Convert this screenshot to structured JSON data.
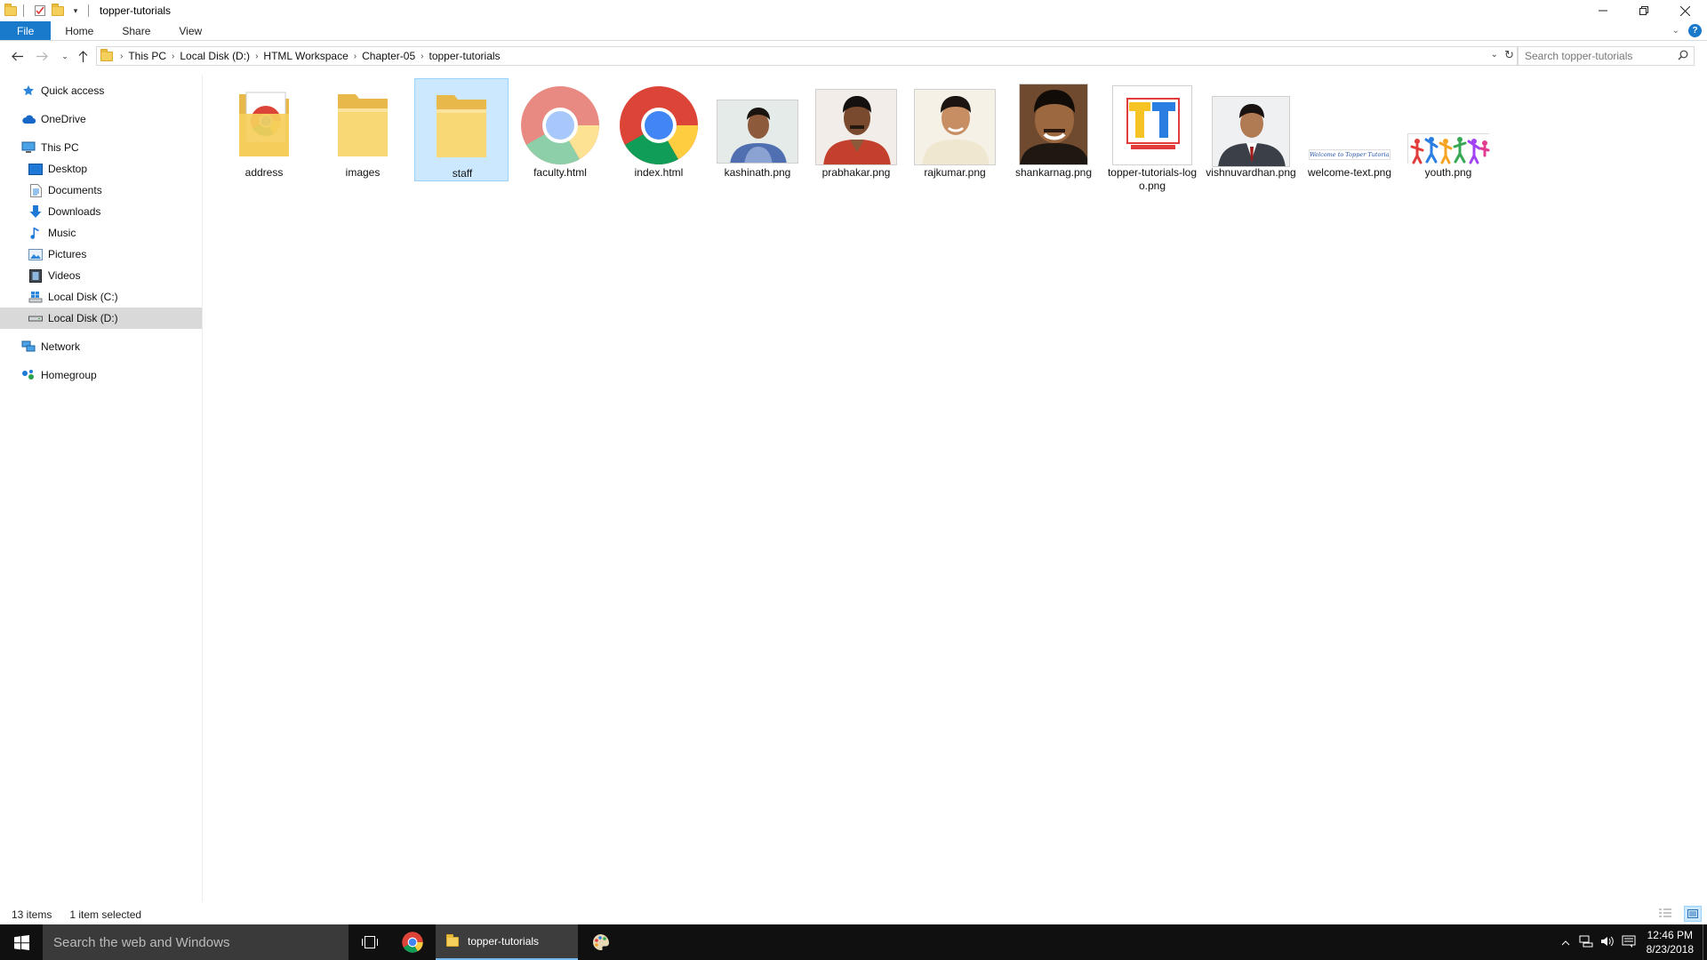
{
  "window": {
    "title": "topper-tutorials"
  },
  "ribbon": {
    "tabs": [
      {
        "label": "File"
      },
      {
        "label": "Home"
      },
      {
        "label": "Share"
      },
      {
        "label": "View"
      }
    ],
    "help_label": "?"
  },
  "address": {
    "crumbs": [
      "This PC",
      "Local Disk (D:)",
      "HTML Workspace",
      "Chapter-05",
      "topper-tutorials"
    ]
  },
  "search": {
    "placeholder": "Search topper-tutorials"
  },
  "sidebar": {
    "items": [
      {
        "label": "Quick access",
        "icon": "star-icon"
      },
      {
        "label": "OneDrive",
        "icon": "cloud-icon"
      },
      {
        "label": "This PC",
        "icon": "computer-icon"
      },
      {
        "label": "Desktop",
        "icon": "desktop-icon"
      },
      {
        "label": "Documents",
        "icon": "documents-icon"
      },
      {
        "label": "Downloads",
        "icon": "download-arrow-icon"
      },
      {
        "label": "Music",
        "icon": "music-note-icon"
      },
      {
        "label": "Pictures",
        "icon": "pictures-icon"
      },
      {
        "label": "Videos",
        "icon": "film-icon"
      },
      {
        "label": "Local Disk (C:)",
        "icon": "windows-drive-icon"
      },
      {
        "label": "Local Disk (D:)",
        "icon": "drive-icon",
        "selected": true
      },
      {
        "label": "Network",
        "icon": "network-icon"
      },
      {
        "label": "Homegroup",
        "icon": "homegroup-icon"
      }
    ]
  },
  "files": [
    {
      "name": "address",
      "kind": "folder-chrome"
    },
    {
      "name": "images",
      "kind": "folder"
    },
    {
      "name": "staff",
      "kind": "folder",
      "selected": true
    },
    {
      "name": "faculty.html",
      "kind": "chrome-faded"
    },
    {
      "name": "index.html",
      "kind": "chrome"
    },
    {
      "name": "kashinath.png",
      "kind": "photo"
    },
    {
      "name": "prabhakar.png",
      "kind": "photo"
    },
    {
      "name": "rajkumar.png",
      "kind": "photo"
    },
    {
      "name": "shankarnag.png",
      "kind": "photo"
    },
    {
      "name": "topper-tutorials-logo.png",
      "kind": "logo",
      "logo_text": "TT"
    },
    {
      "name": "vishnuvardhan.png",
      "kind": "photo"
    },
    {
      "name": "welcome-text.png",
      "kind": "banner",
      "banner_text": "Welcome to Topper Tutorials"
    },
    {
      "name": "youth.png",
      "kind": "youth"
    }
  ],
  "status": {
    "count": "13 items",
    "selection": "1 item selected"
  },
  "taskbar": {
    "search_placeholder": "Search the web and Windows",
    "active_app_label": "topper-tutorials",
    "time": "12:46 PM",
    "date": "8/23/2018"
  },
  "colors": {
    "accent": "#1979ca",
    "selection_bg": "#cce8ff",
    "selection_border": "#99d1ff",
    "folder": "#f5cf5c",
    "taskbar": "#101010"
  }
}
